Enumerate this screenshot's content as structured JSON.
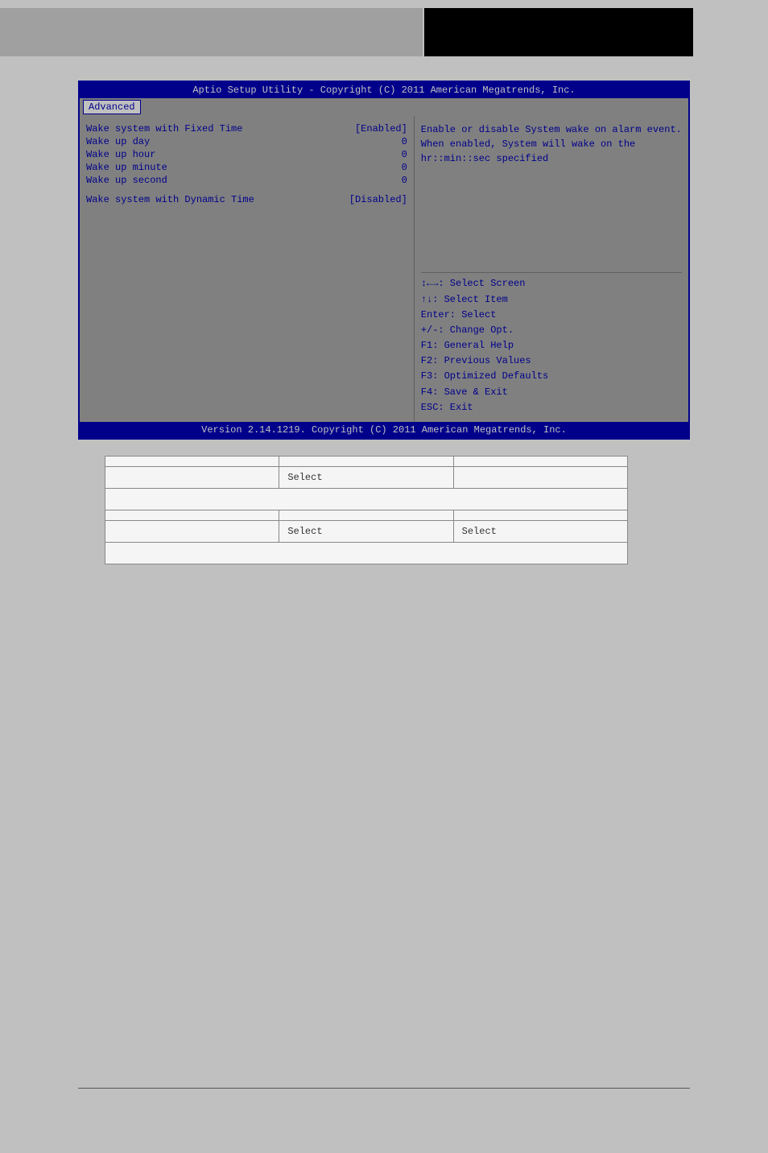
{
  "header": {
    "left_bg": "gray",
    "right_bg": "black"
  },
  "bios": {
    "title": "Aptio Setup Utility - Copyright (C) 2011 American Megatrends, Inc.",
    "tab": "Advanced",
    "items": [
      {
        "label": "Wake system with Fixed Time",
        "value": "[Enabled]"
      },
      {
        "label": "Wake up day",
        "value": "0"
      },
      {
        "label": "Wake up hour",
        "value": "0"
      },
      {
        "label": "Wake up minute",
        "value": "0"
      },
      {
        "label": "Wake up second",
        "value": "0"
      },
      {
        "label": "",
        "value": ""
      },
      {
        "label": "Wake system with Dynamic Time",
        "value": "[Disabled]"
      }
    ],
    "help_text": "Enable or disable System wake on alarm event. When enabled, System will wake on the hr::min::sec specified",
    "keys": [
      "↕←→: Select Screen",
      "↑↓: Select Item",
      "Enter: Select",
      "+/-: Change Opt.",
      "F1: General Help",
      "F2: Previous Values",
      "F3: Optimized Defaults",
      "F4: Save & Exit",
      "ESC: Exit"
    ],
    "version": "Version 2.14.1219. Copyright (C) 2011 American Megatrends, Inc."
  },
  "table": {
    "rows": [
      {
        "type": "split",
        "cells": [
          "",
          "",
          ""
        ]
      },
      {
        "type": "split",
        "cells": [
          "",
          "Select",
          ""
        ]
      },
      {
        "type": "full",
        "text": ""
      },
      {
        "type": "split",
        "cells": [
          "",
          "",
          ""
        ]
      },
      {
        "type": "split",
        "cells": [
          "",
          "Select",
          "Select"
        ]
      },
      {
        "type": "full",
        "text": ""
      }
    ]
  }
}
